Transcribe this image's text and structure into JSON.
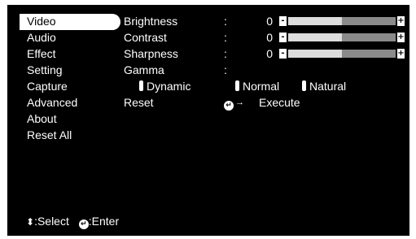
{
  "menu": {
    "items": [
      {
        "label": "Video",
        "selected": true
      },
      {
        "label": "Audio"
      },
      {
        "label": "Effect"
      },
      {
        "label": "Setting"
      },
      {
        "label": "Capture"
      },
      {
        "label": "Advanced"
      },
      {
        "label": "About"
      },
      {
        "label": "Reset All"
      }
    ]
  },
  "video": {
    "separator": ":",
    "brightness": {
      "label": "Brightness",
      "value": "0",
      "level": 0.5
    },
    "contrast": {
      "label": "Contrast",
      "value": "0",
      "level": 0.5
    },
    "sharpness": {
      "label": "Sharpness",
      "value": "0",
      "level": 0.5
    },
    "gamma": {
      "label": "Gamma",
      "options": [
        "Dynamic",
        "Normal",
        "Natural"
      ]
    },
    "reset": {
      "label": "Reset",
      "action": "Execute",
      "arrow": "→"
    }
  },
  "slider": {
    "minus": "-",
    "plus": "+"
  },
  "footer": {
    "select_glyph": "⬍",
    "select_label": ":Select",
    "enter_label": ":Enter"
  },
  "icons": {
    "enter": "enter-icon",
    "updown": "up-down-arrows-icon",
    "arrow": "right-arrow-icon"
  },
  "colors": {
    "background": "#000000",
    "text": "#ffffff",
    "track": "#8a8a8a",
    "fill": "#dcdcdc"
  }
}
